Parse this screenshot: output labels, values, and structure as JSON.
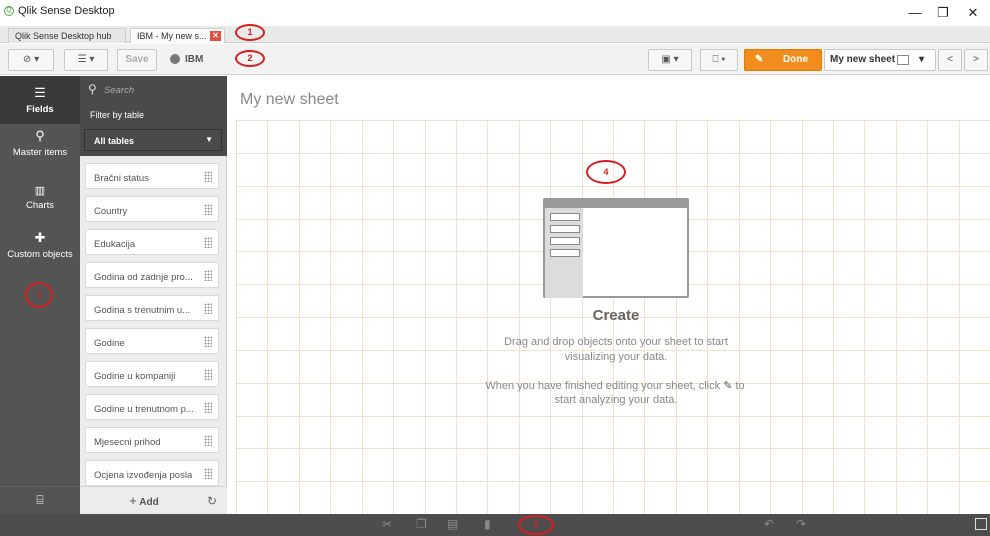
{
  "window": {
    "title": "Qlik Sense Desktop",
    "app_icon_glyph": "Q",
    "minimize_glyph": "—",
    "restore_glyph": "❐",
    "close_glyph": "✕"
  },
  "tabs": [
    {
      "label": "Qlik Sense Desktop hub"
    },
    {
      "label": "IBM - My new s...",
      "close_glyph": "✕"
    }
  ],
  "annotations": [
    "1",
    "2",
    "3",
    "4",
    "5"
  ],
  "toolbar": {
    "nav_glyph": "⊘ ▾",
    "list_glyph": "☰ ▾",
    "save_label": "Save",
    "app_name": "IBM",
    "present_glyph": "▣ ▾",
    "bookmark_glyph": "⎕ ▾",
    "done_label": "Done",
    "sheet_name": "My new sheet",
    "prev_glyph": "<",
    "next_glyph": ">"
  },
  "rail": {
    "items": [
      {
        "label": "Fields",
        "icon": "database-icon"
      },
      {
        "label": "Master items",
        "icon": "link-icon"
      },
      {
        "label": "Charts",
        "icon": "chart-icon"
      },
      {
        "label": "Custom objects",
        "icon": "puzzle-icon"
      }
    ]
  },
  "fields_panel": {
    "search_placeholder": "Search",
    "filter_label": "Filter by table",
    "filter_value": "All tables",
    "fields": [
      "Bračni status",
      "Country",
      "Edukacija",
      "Godina od zadnje pro...",
      "Godina s trenutnim u...",
      "Godine",
      "Godine u kompaniji",
      "Godine u trenutnom p...",
      "Mjesecni prihod",
      "Ocjena izvođenja posla"
    ],
    "add_label": "Add"
  },
  "sheet": {
    "title": "My new sheet",
    "create_heading": "Create",
    "create_text_1": "Drag and drop objects onto your sheet to start",
    "create_text_2": "visualizing your data.",
    "create_text_3a": "When you have finished editing your sheet, click",
    "create_text_3b": "to",
    "create_text_4": "start analyzing your data."
  },
  "colors": {
    "accent": "#f28c1c",
    "annotation": "#d42020",
    "grid": "#f4dfc9"
  }
}
